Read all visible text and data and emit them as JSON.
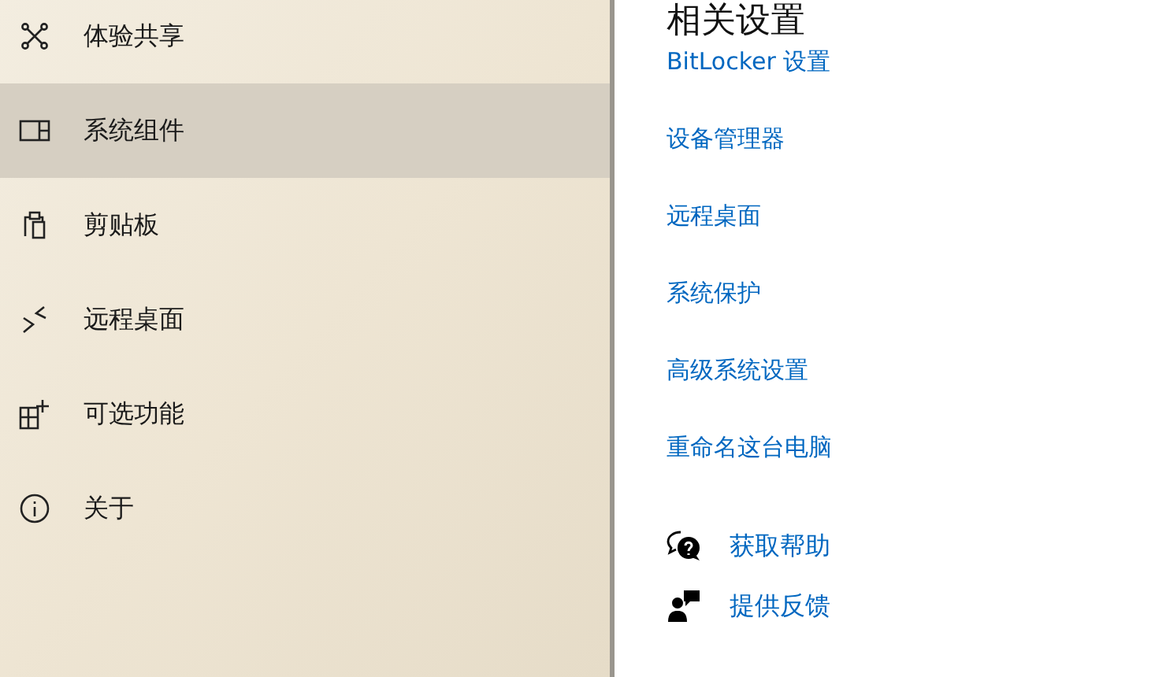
{
  "sidebar": {
    "items": [
      {
        "label": "体验共享",
        "kind": "share",
        "selected": false
      },
      {
        "label": "系统组件",
        "kind": "components",
        "selected": true
      },
      {
        "label": "剪贴板",
        "kind": "clipboard",
        "selected": false
      },
      {
        "label": "远程桌面",
        "kind": "remote",
        "selected": false
      },
      {
        "label": "可选功能",
        "kind": "optional",
        "selected": false
      },
      {
        "label": "关于",
        "kind": "info",
        "selected": false
      }
    ]
  },
  "related": {
    "title": "相关设置",
    "links": [
      "BitLocker 设置",
      "设备管理器",
      "远程桌面",
      "系统保护",
      "高级系统设置",
      "重命名这台电脑"
    ]
  },
  "support": [
    {
      "label": "获取帮助",
      "kind": "help"
    },
    {
      "label": "提供反馈",
      "kind": "feedback"
    }
  ]
}
